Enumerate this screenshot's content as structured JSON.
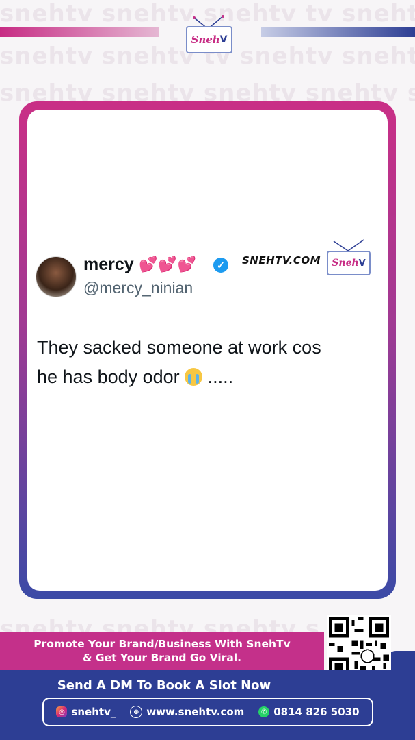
{
  "watermark": {
    "row1": "snehtv snehtv   snehtv   tv snehtv snehtv",
    "row2": "snehtv snehtv              tv snehtv snehtv",
    "row3": "snehtv snehtv snehtv snehtv snehtv snehtv",
    "row_bottom": "snehtv snehtv snehtv snehtv snehtv snehtv"
  },
  "brand": {
    "logo_text": "Sneh",
    "site_label": "SNEHTV.COM",
    "colors": {
      "pink": "#c4308a",
      "blue": "#2d3e94"
    }
  },
  "tweet": {
    "name": "mercy",
    "name_emoji": "💕💕💕",
    "verified": "✓",
    "handle": "@mercy_ninian",
    "text_line1": "They sacked someone at work cos",
    "text_line2_before": "he has body odor ",
    "text_line2_after": " .....",
    "emoji_icon": "loudly-crying-face-icon"
  },
  "promo": {
    "line1": "Promote Your Brand/Business With SnehTv",
    "line2": "& Get Your Brand Go Viral.",
    "dm": "Send A DM To Book A Slot Now",
    "instagram": "snehtv_",
    "website": "www.snehtv.com",
    "whatsapp": "0814 826 5030"
  }
}
